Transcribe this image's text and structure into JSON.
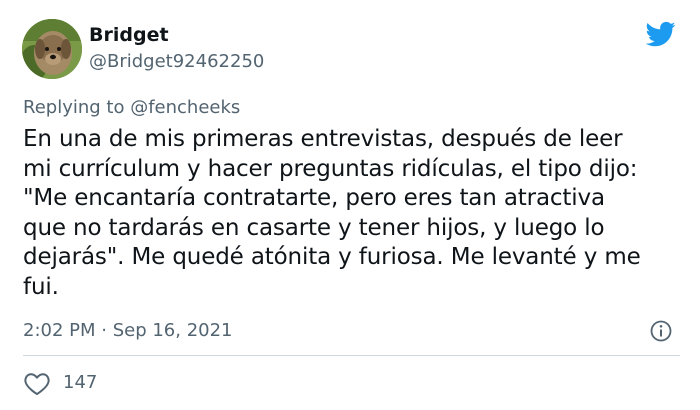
{
  "author": {
    "name": "Bridget",
    "handle": "@Bridget92462250",
    "avatar_icon": "dog-avatar"
  },
  "brand": {
    "icon": "twitter-bird-icon",
    "color": "#1d9bf0"
  },
  "reply": {
    "prefix": "Replying to ",
    "mention": "@fencheeks"
  },
  "tweet": {
    "text": "En una de mis primeras entrevistas, después de leer\nmi currículum y hacer preguntas ridículas, el tipo dijo:\n\"Me encantaría contratarte, pero eres tan atractiva\nque no tardarás en casarte y tener hijos, y luego lo\ndejarás\". Me quedé atónita y furiosa.  Me levanté y me\nfui."
  },
  "meta": {
    "timestamp": "2:02 PM · Sep 16, 2021",
    "info_icon": "info-icon"
  },
  "actions": {
    "like_icon": "heart-icon",
    "like_count": "147"
  },
  "colors": {
    "text_primary": "#0f1419",
    "text_secondary": "#536471",
    "divider": "#cfd9de"
  }
}
